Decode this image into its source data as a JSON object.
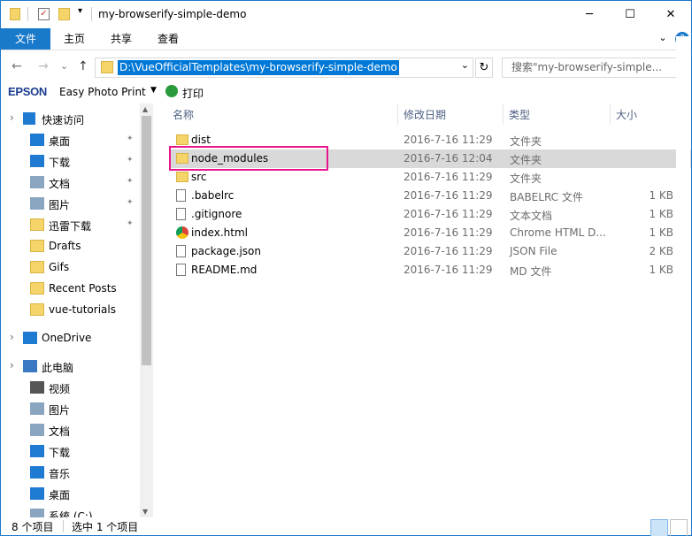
{
  "window": {
    "title": "my-browserify-simple-demo",
    "minimize": "─",
    "maximize": "☐",
    "close": "✕"
  },
  "ribbon": {
    "tabs": [
      "文件",
      "主页",
      "共享",
      "查看"
    ],
    "expand": "⌄",
    "help": "?"
  },
  "address": {
    "back": "←",
    "forward": "→",
    "recent": "⌄",
    "up": "↑",
    "path": "D:\\VueOfficialTemplates\\my-browserify-simple-demo",
    "dropdown": "⌄",
    "refresh": "↻",
    "search_placeholder": "搜索\"my-browserify-simple...",
    "search_icon": "🔍"
  },
  "toolbar": {
    "brand": "EPSON",
    "app": "Easy Photo Print",
    "app_arrow": "▼",
    "print": "打印"
  },
  "nav": {
    "items": [
      {
        "label": "快速访问",
        "icon": "star-icon",
        "pinned": false
      },
      {
        "label": "桌面",
        "icon": "desktop-icon",
        "pinned": true
      },
      {
        "label": "下载",
        "icon": "download-icon",
        "pinned": true
      },
      {
        "label": "文档",
        "icon": "document-icon",
        "pinned": true
      },
      {
        "label": "图片",
        "icon": "picture-icon",
        "pinned": true
      },
      {
        "label": "迅雷下载",
        "icon": "folder-icon",
        "pinned": true
      },
      {
        "label": "Drafts",
        "icon": "folder-icon",
        "pinned": false
      },
      {
        "label": "Gifs",
        "icon": "folder-icon",
        "pinned": false
      },
      {
        "label": "Recent Posts",
        "icon": "folder-icon",
        "pinned": false
      },
      {
        "label": "vue-tutorials",
        "icon": "folder-icon",
        "pinned": false
      },
      {
        "label": "OneDrive",
        "icon": "cloud-icon",
        "pinned": false
      },
      {
        "label": "此电脑",
        "icon": "computer-icon",
        "pinned": false
      },
      {
        "label": "视频",
        "icon": "video-icon",
        "pinned": false
      },
      {
        "label": "图片",
        "icon": "picture-icon",
        "pinned": false
      },
      {
        "label": "文档",
        "icon": "document-icon",
        "pinned": false
      },
      {
        "label": "下载",
        "icon": "download-icon",
        "pinned": false
      },
      {
        "label": "音乐",
        "icon": "music-icon",
        "pinned": false
      },
      {
        "label": "桌面",
        "icon": "desktop-icon",
        "pinned": false
      },
      {
        "label": "系统 (C:)",
        "icon": "drive-icon",
        "pinned": false
      }
    ],
    "pin_glyph": "📌"
  },
  "columns": [
    "名称",
    "修改日期",
    "类型",
    "大小"
  ],
  "files": [
    {
      "name": "dist",
      "date": "2016-7-16 11:29",
      "type": "文件夹",
      "size": "",
      "icon": "folder-icon"
    },
    {
      "name": "node_modules",
      "date": "2016-7-16 12:04",
      "type": "文件夹",
      "size": "",
      "icon": "folder-icon"
    },
    {
      "name": "src",
      "date": "2016-7-16 11:29",
      "type": "文件夹",
      "size": "",
      "icon": "folder-icon"
    },
    {
      "name": ".babelrc",
      "date": "2016-7-16 11:29",
      "type": "BABELRC 文件",
      "size": "1 KB",
      "icon": "file-icon"
    },
    {
      "name": ".gitignore",
      "date": "2016-7-16 11:29",
      "type": "文本文档",
      "size": "1 KB",
      "icon": "text-file-icon"
    },
    {
      "name": "index.html",
      "date": "2016-7-16 11:29",
      "type": "Chrome HTML D...",
      "size": "1 KB",
      "icon": "chrome-icon"
    },
    {
      "name": "package.json",
      "date": "2016-7-16 11:29",
      "type": "JSON File",
      "size": "2 KB",
      "icon": "json-file-icon"
    },
    {
      "name": "README.md",
      "date": "2016-7-16 11:29",
      "type": "MD 文件",
      "size": "1 KB",
      "icon": "md-file-icon"
    }
  ],
  "status": {
    "count": "8 个项目",
    "selected": "选中 1 个项目"
  }
}
